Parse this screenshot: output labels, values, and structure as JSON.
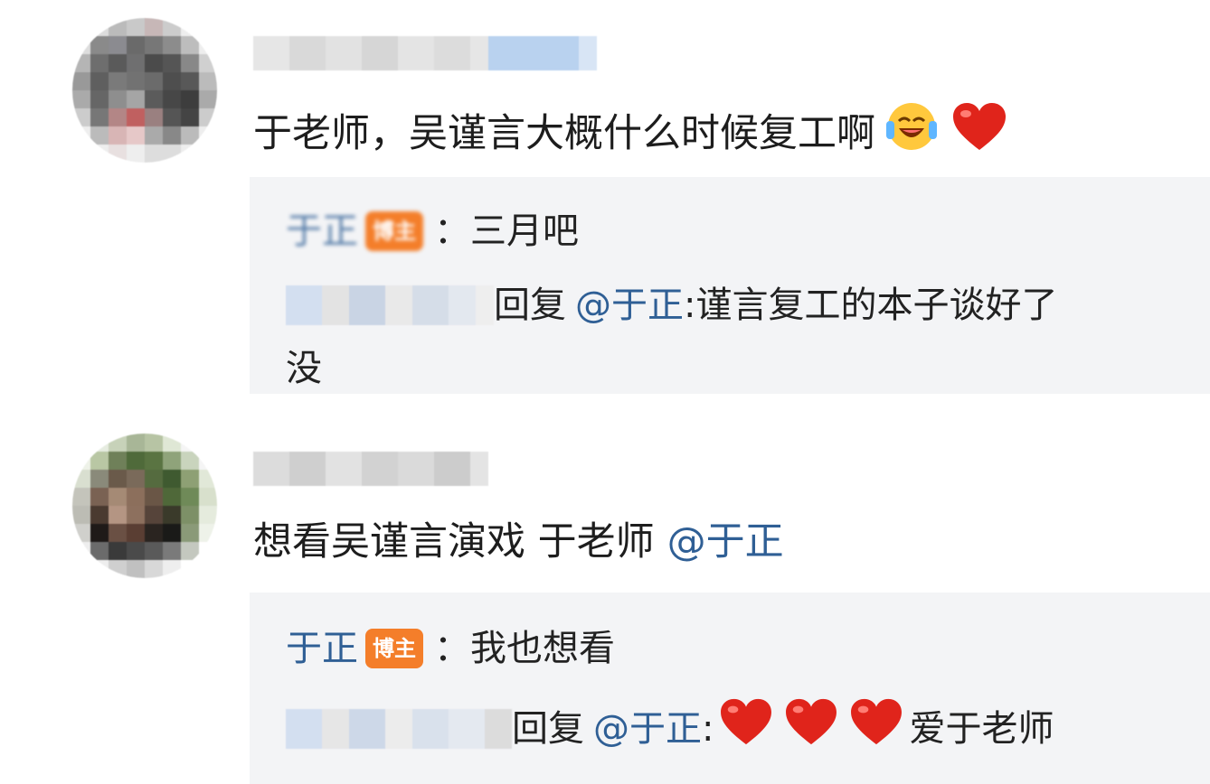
{
  "comments": [
    {
      "text": "于老师，吴谨言大概什么时候复工啊",
      "emojis": [
        "laughing-tears-icon",
        "heart-icon"
      ],
      "replies": [
        {
          "author": "于正",
          "badge": "博主",
          "sep": "：",
          "text": "三月吧"
        },
        {
          "reply_prefix": "回复",
          "mention": "@于正",
          "colon": ":",
          "text": "谨言复工的本子谈好了",
          "text_wrap": "没"
        }
      ]
    },
    {
      "text": "想看吴谨言演戏 于老师",
      "mention": "@于正",
      "replies": [
        {
          "author": "于正",
          "badge": "博主",
          "sep": "：",
          "text": "我也想看"
        },
        {
          "reply_prefix": "回复",
          "mention": "@于正",
          "colon": ":",
          "hearts": [
            "heart-icon",
            "heart-icon",
            "heart-icon"
          ],
          "text": "爱于老师"
        }
      ]
    }
  ],
  "colors": {
    "mention": "#2f5f95",
    "badge": "#f47e2a",
    "reply_bg": "#f3f4f6",
    "heart": "#e0241b"
  }
}
